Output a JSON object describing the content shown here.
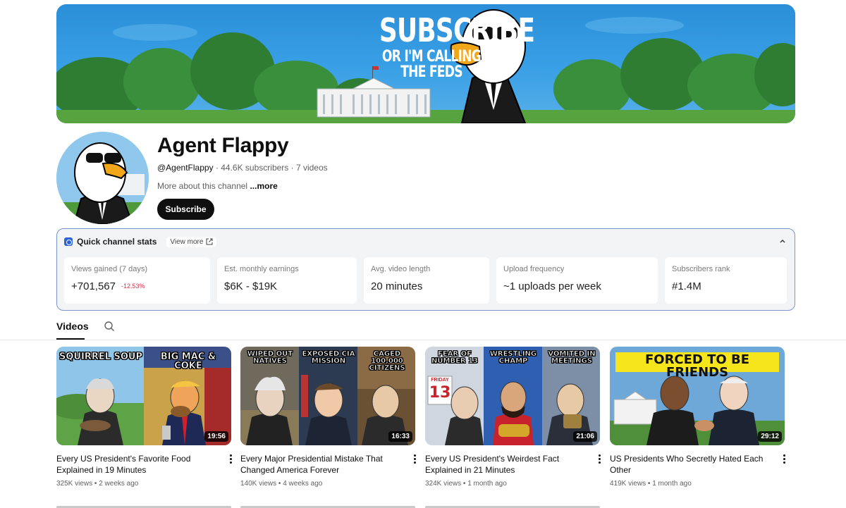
{
  "banner": {
    "line1": "SUBSCRIBE",
    "line2": "OR I'M CALLING THE FEDS"
  },
  "channel": {
    "name": "Agent Flappy",
    "handle": "@AgentFlappy",
    "subscribers": "44.6K subscribers",
    "video_count": "7 videos",
    "separator": " · ",
    "about_label": "More about this channel",
    "about_more": "...more",
    "subscribe_label": "Subscribe"
  },
  "stats": {
    "title": "Quick channel stats",
    "view_more": "View more",
    "cards": [
      {
        "label": "Views gained (7 days)",
        "value": "+701,567",
        "change": "-12.53%"
      },
      {
        "label": "Est. monthly earnings",
        "value": "$6K - $19K"
      },
      {
        "label": "Avg. video length",
        "value": "20 minutes"
      },
      {
        "label": "Upload frequency",
        "value": "~1 uploads per week"
      },
      {
        "label": "Subscribers rank",
        "value": "#1.4M"
      }
    ],
    "change_color": "#d6304a",
    "accent": "#2b63d6"
  },
  "tabs": {
    "videos": "Videos",
    "search_icon": "search-icon"
  },
  "videos": [
    {
      "title": "Every US President's Favorite Food Explained in 19 Minutes",
      "views": "325K views",
      "age": "2 weeks ago",
      "duration": "19:56",
      "thumb_text": [
        "SQUIRREL SOUP",
        "BIG MAC & COKE"
      ]
    },
    {
      "title": "Every Major Presidential Mistake That Changed America Forever",
      "views": "140K views",
      "age": "4 weeks ago",
      "duration": "16:33",
      "thumb_text": [
        "WIPED OUT NATIVES",
        "EXPOSED CIA MISSION",
        "CAGED 100,000 CITIZENS"
      ]
    },
    {
      "title": "Every US President's Weirdest Fact Explained in 21 Minutes",
      "views": "324K views",
      "age": "1 month ago",
      "duration": "21:06",
      "thumb_text": [
        "FEAR OF NUMBER 13",
        "WRESTLING CHAMP",
        "VOMITED IN MEETINGS",
        "FRIDAY",
        "13"
      ]
    },
    {
      "title": "US Presidents Who Secretly Hated Each Other",
      "views": "419K views",
      "age": "1 month ago",
      "duration": "29:12",
      "thumb_text": [
        "FORCED TO BE FRIENDS"
      ]
    }
  ],
  "meta_separator": " • "
}
